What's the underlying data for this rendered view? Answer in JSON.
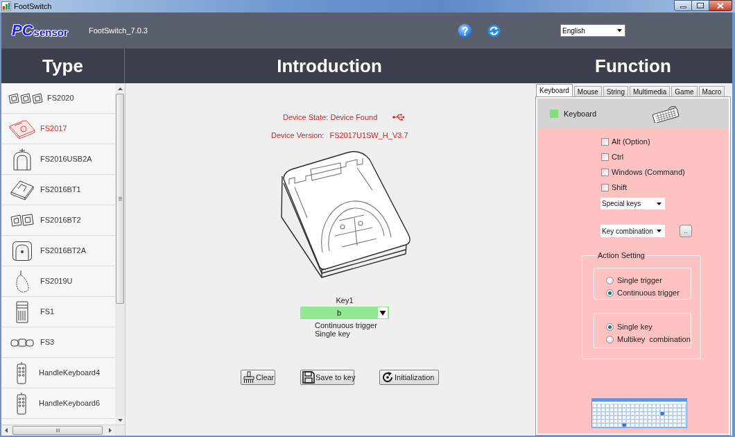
{
  "window": {
    "title": "FootSwitch"
  },
  "header": {
    "logo": {
      "initials": "PC",
      "word": "sensor"
    },
    "version": "FootSwitch_7.0.3",
    "language": "English"
  },
  "column_headings": [
    "Type",
    "Introduction",
    "Function"
  ],
  "type_list": {
    "items": [
      {
        "label": "FS2020",
        "kind": "triple",
        "selected": false
      },
      {
        "label": "FS2017",
        "kind": "pedal",
        "selected": true
      },
      {
        "label": "FS2016USB2A",
        "kind": "arch",
        "selected": false
      },
      {
        "label": "FS2016BT1",
        "kind": "slab",
        "selected": false
      },
      {
        "label": "FS2016BT2",
        "kind": "double",
        "selected": false
      },
      {
        "label": "FS2016BT2A",
        "kind": "dome",
        "selected": false
      },
      {
        "label": "FS2019U",
        "kind": "teardrop",
        "selected": false
      },
      {
        "label": "FS1",
        "kind": "tower",
        "selected": false
      },
      {
        "label": "FS3",
        "kind": "strip",
        "selected": false
      },
      {
        "label": "HandleKeyboard4",
        "kind": "handle",
        "selected": false
      },
      {
        "label": "HandleKeyboard6",
        "kind": "handle",
        "selected": false
      }
    ]
  },
  "introduction": {
    "device_state": "Device State: Device Found",
    "device_version": {
      "label": "Device Version:",
      "value": "FS2017U1SW_H_V3.7"
    },
    "key": {
      "label": "Key1",
      "value": "b"
    },
    "settings": [
      "Continuous trigger",
      "Single key"
    ],
    "buttons": [
      {
        "label": "Clear",
        "kind": "clear"
      },
      {
        "label": "Save to key",
        "kind": "save"
      },
      {
        "label": "Initialization",
        "kind": "reset"
      }
    ]
  },
  "function": {
    "tabs": [
      {
        "label": "Keyboard",
        "selected": true
      },
      {
        "label": "Mouse",
        "selected": false
      },
      {
        "label": "String",
        "selected": false
      },
      {
        "label": "Multimedia",
        "selected": false
      },
      {
        "label": "Game",
        "selected": false
      },
      {
        "label": "Macro",
        "selected": false
      }
    ],
    "mode": "Keyboard",
    "modifiers": [
      {
        "label": "Alt (Option)",
        "checked": false
      },
      {
        "label": "Ctrl",
        "checked": false
      },
      {
        "label": "Windows (Command)",
        "checked": false
      },
      {
        "label": "Shift",
        "checked": false
      }
    ],
    "special_keys": "Special keys",
    "key_combination": "Key combination",
    "more_button": "..",
    "action_setting": {
      "title": "Action Setting",
      "trigger_options": [
        {
          "label": "Single trigger",
          "selected": false
        },
        {
          "label": "Continuous trigger",
          "selected": true
        }
      ],
      "key_options": [
        {
          "label": "Single key",
          "selected": true
        },
        {
          "label": "Multikey  combination",
          "selected": false
        }
      ]
    }
  }
}
